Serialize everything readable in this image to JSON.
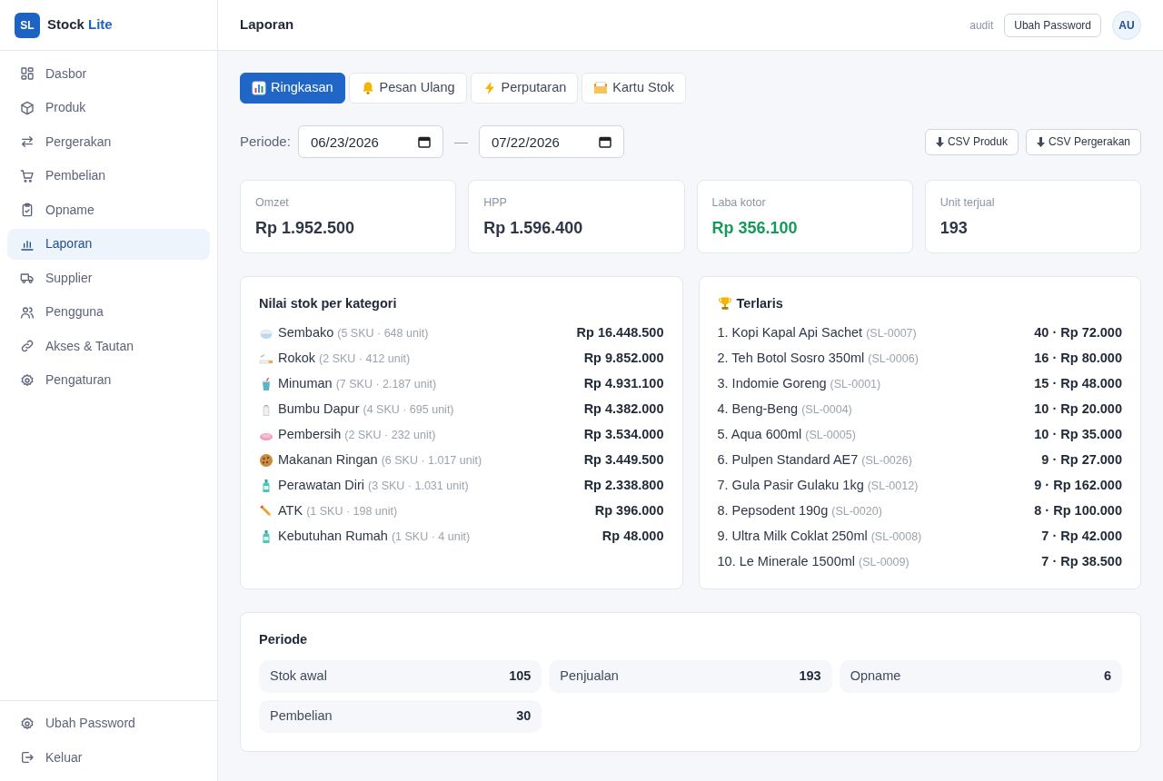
{
  "sidebar": {
    "brand": {
      "badge": "SL",
      "name": "Stock",
      "accent": "Lite"
    },
    "items": [
      {
        "label": "Dasbor",
        "selected": false
      },
      {
        "label": "Produk",
        "selected": false
      },
      {
        "label": "Pergerakan",
        "selected": false
      },
      {
        "label": "Pembelian",
        "selected": false
      },
      {
        "label": "Opname",
        "selected": false
      },
      {
        "label": "Laporan",
        "selected": true
      },
      {
        "label": "Supplier",
        "selected": false
      },
      {
        "label": "Pengguna",
        "selected": false
      },
      {
        "label": "Akses & Tautan",
        "selected": false
      },
      {
        "label": "Pengaturan",
        "selected": false
      }
    ],
    "footer_items": [
      {
        "label": "Ubah Password"
      },
      {
        "label": "Keluar"
      }
    ]
  },
  "header": {
    "title": "Laporan",
    "user": "audit",
    "button": "Ubah Password",
    "avatar": "AU"
  },
  "tabs": [
    {
      "label": "Ringkasan",
      "selected": true
    },
    {
      "label": "Pesan Ulang",
      "selected": false
    },
    {
      "label": "Perputaran",
      "selected": false
    },
    {
      "label": "Kartu Stok",
      "selected": false
    }
  ],
  "period_filter": {
    "label": "Periode:",
    "from": "06/23/2026",
    "separator": "—",
    "to": "07/22/2026"
  },
  "exports": [
    "CSV Produk",
    "CSV Pergerakan"
  ],
  "stats": [
    {
      "label": "Omzet",
      "value": "Rp 1.952.500",
      "positive": false
    },
    {
      "label": "HPP",
      "value": "Rp 1.596.400",
      "positive": false
    },
    {
      "label": "Laba kotor",
      "value": "Rp 356.100",
      "positive": true
    },
    {
      "label": "Unit terjual",
      "value": "193",
      "positive": false
    }
  ],
  "stock_by_category": {
    "title": "Nilai stok per kategori",
    "rows": [
      {
        "name": "Sembako",
        "meta": "(5 SKU · 648 unit)",
        "value": "Rp 16.448.500"
      },
      {
        "name": "Rokok",
        "meta": "(2 SKU · 412 unit)",
        "value": "Rp 9.852.000"
      },
      {
        "name": "Minuman",
        "meta": "(7 SKU · 2.187 unit)",
        "value": "Rp 4.931.100"
      },
      {
        "name": "Bumbu Dapur",
        "meta": "(4 SKU · 695 unit)",
        "value": "Rp 4.382.000"
      },
      {
        "name": "Pembersih",
        "meta": "(2 SKU · 232 unit)",
        "value": "Rp 3.534.000"
      },
      {
        "name": "Makanan Ringan",
        "meta": "(6 SKU · 1.017 unit)",
        "value": "Rp 3.449.500"
      },
      {
        "name": "Perawatan Diri",
        "meta": "(3 SKU · 1.031 unit)",
        "value": "Rp 2.338.800"
      },
      {
        "name": "ATK",
        "meta": "(1 SKU · 198 unit)",
        "value": "Rp 396.000"
      },
      {
        "name": "Kebutuhan Rumah",
        "meta": "(1 SKU · 4 unit)",
        "value": "Rp 48.000"
      }
    ]
  },
  "best_sellers": {
    "title": "Terlaris",
    "rows": [
      {
        "name": "1. Kopi Kapal Api Sachet",
        "code": "(SL-0007)",
        "value": "40 · Rp 72.000"
      },
      {
        "name": "2. Teh Botol Sosro 350ml",
        "code": "(SL-0006)",
        "value": "16 · Rp 80.000"
      },
      {
        "name": "3. Indomie Goreng",
        "code": "(SL-0001)",
        "value": "15 · Rp 48.000"
      },
      {
        "name": "4. Beng-Beng",
        "code": "(SL-0004)",
        "value": "10 · Rp 20.000"
      },
      {
        "name": "5. Aqua 600ml",
        "code": "(SL-0005)",
        "value": "10 · Rp 35.000"
      },
      {
        "name": "6. Pulpen Standard AE7",
        "code": "(SL-0026)",
        "value": "9 · Rp 27.000"
      },
      {
        "name": "7. Gula Pasir Gulaku 1kg",
        "code": "(SL-0012)",
        "value": "9 · Rp 162.000"
      },
      {
        "name": "8. Pepsodent 190g",
        "code": "(SL-0020)",
        "value": "8 · Rp 100.000"
      },
      {
        "name": "9. Ultra Milk Coklat 250ml",
        "code": "(SL-0008)",
        "value": "7 · Rp 42.000"
      },
      {
        "name": "10. Le Minerale 1500ml",
        "code": "(SL-0009)",
        "value": "7 · Rp 38.500"
      }
    ]
  },
  "period_summary": {
    "title": "Periode",
    "items": [
      {
        "label": "Stok awal",
        "value": "105"
      },
      {
        "label": "Penjualan",
        "value": "193"
      },
      {
        "label": "Opname",
        "value": "6"
      },
      {
        "label": "Pembelian",
        "value": "30"
      }
    ]
  }
}
